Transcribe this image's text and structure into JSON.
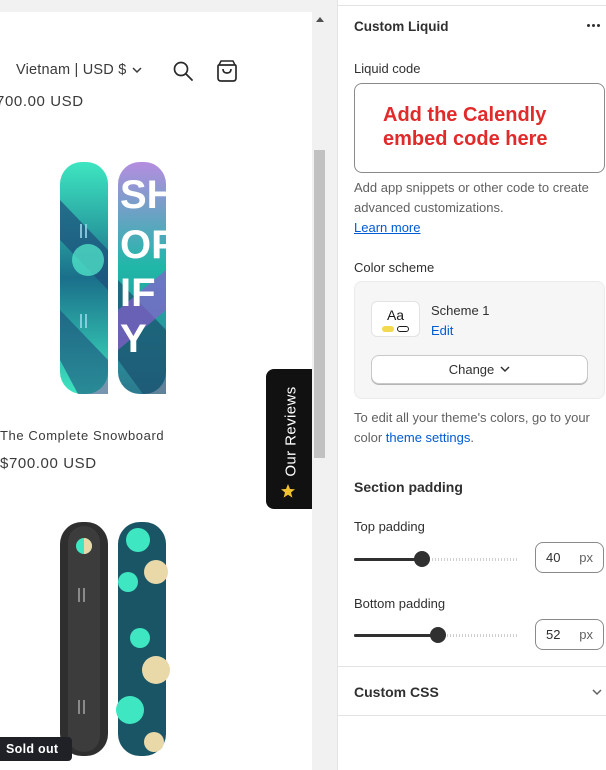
{
  "preview": {
    "header": {
      "locale_label": "Vietnam | USD $",
      "chevron": "▾"
    },
    "products": {
      "partial_price": "700.00 USD",
      "title": "The Complete Snowboard",
      "price": "$700.00 USD",
      "sold_out_badge": "Sold out"
    },
    "reviews_tab": {
      "label": "Our Reviews",
      "icon": "star-icon"
    }
  },
  "panel": {
    "title": "Custom Liquid",
    "more_icon": "ellipsis-icon",
    "liquid_code": {
      "label": "Liquid code",
      "value": "Add the Calendly embed code here",
      "help_text": "Add app snippets or other code to create advanced customizations.",
      "learn_more": "Learn more"
    },
    "color_scheme": {
      "label": "Color scheme",
      "swatch_text": "Aa",
      "scheme_name": "Scheme 1",
      "edit_label": "Edit",
      "change_label": "Change",
      "help_prefix": "To edit all your theme's colors, go to your color ",
      "help_link": "theme settings",
      "help_suffix": "."
    },
    "section_padding": {
      "heading": "Section padding",
      "top": {
        "label": "Top padding",
        "value": "40",
        "unit": "px",
        "fraction": 0.41
      },
      "bottom": {
        "label": "Bottom padding",
        "value": "52",
        "unit": "px",
        "fraction": 0.51
      }
    },
    "custom_css": {
      "heading": "Custom CSS"
    }
  },
  "colors": {
    "annotation_red": "#e12a2a",
    "link_blue": "#005bd3",
    "swatch_yellow": "#f2d94e",
    "board_teal": "#3ee6c1",
    "reviews_tab_bg": "#111111"
  }
}
